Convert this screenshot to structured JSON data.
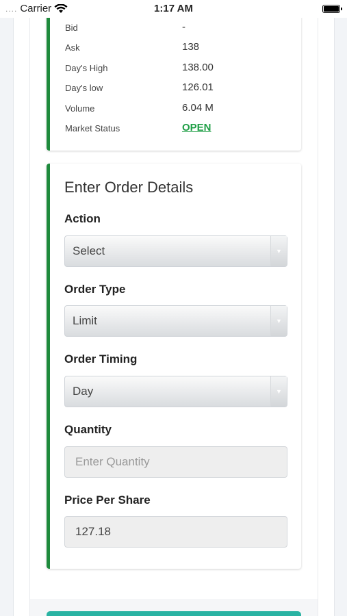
{
  "status_bar": {
    "signal": "....",
    "carrier": "Carrier",
    "time": "1:17 AM"
  },
  "quote": {
    "rows": [
      {
        "label": "Bid",
        "value": "-"
      },
      {
        "label": "Ask",
        "value": "138"
      },
      {
        "label": "Day's High",
        "value": "138.00"
      },
      {
        "label": "Day's low",
        "value": "126.01"
      },
      {
        "label": "Volume",
        "value": "6.04 M"
      },
      {
        "label": "Market Status",
        "value": "OPEN"
      }
    ]
  },
  "order": {
    "title": "Enter Order Details",
    "action": {
      "label": "Action",
      "value": "Select"
    },
    "order_type": {
      "label": "Order Type",
      "value": "Limit"
    },
    "order_timing": {
      "label": "Order Timing",
      "value": "Day"
    },
    "quantity": {
      "label": "Quantity",
      "placeholder": "Enter Quantity"
    },
    "price": {
      "label": "Price Per Share",
      "value": "127.18"
    }
  },
  "colors": {
    "accent_green": "#1e8a3c",
    "status_open": "#1e9e45",
    "button_teal": "#2ab3a3"
  }
}
